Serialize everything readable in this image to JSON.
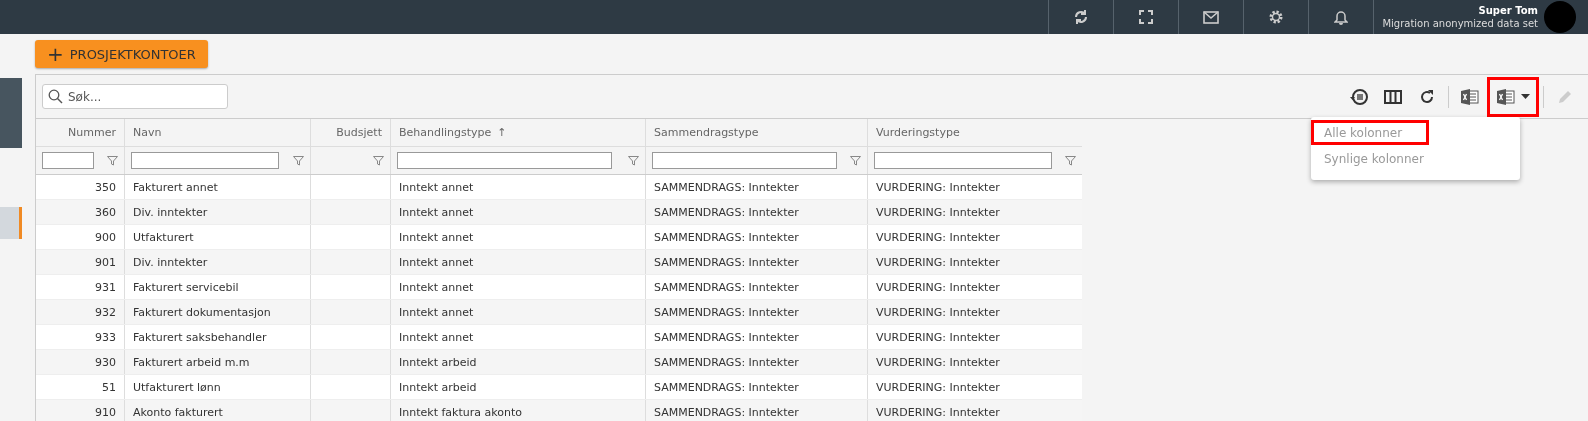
{
  "header": {
    "user_name": "Super Tom",
    "dataset": "Migration anonymized data set"
  },
  "add_button": {
    "icon": "+",
    "label": "PROSJEKTKONTOER"
  },
  "search": {
    "placeholder": "Søk..."
  },
  "toolbar": {
    "export_button": {
      "highlighted": true
    },
    "menu": [
      {
        "label": "Alle kolonner",
        "highlighted": true
      },
      {
        "label": "Synlige kolonner",
        "highlighted": false
      }
    ]
  },
  "table": {
    "columns": [
      {
        "label": "Nummer",
        "numeric": true,
        "sorted": false
      },
      {
        "label": "Navn",
        "numeric": false,
        "sorted": false
      },
      {
        "label": "Budsjett",
        "numeric": true,
        "sorted": false
      },
      {
        "label": "Behandlingstype",
        "numeric": false,
        "sorted": true
      },
      {
        "label": "Sammendragstype",
        "numeric": false,
        "sorted": false
      },
      {
        "label": "Vurderingstype",
        "numeric": false,
        "sorted": false
      }
    ],
    "sort_icon": "↑",
    "rows": [
      [
        "350",
        "Fakturert annet",
        "",
        "Inntekt annet",
        "SAMMENDRAGS: Inntekter",
        "VURDERING: Inntekter"
      ],
      [
        "360",
        "Div. inntekter",
        "",
        "Inntekt annet",
        "SAMMENDRAGS: Inntekter",
        "VURDERING: Inntekter"
      ],
      [
        "900",
        "Utfakturert",
        "",
        "Inntekt annet",
        "SAMMENDRAGS: Inntekter",
        "VURDERING: Inntekter"
      ],
      [
        "901",
        "Div. inntekter",
        "",
        "Inntekt annet",
        "SAMMENDRAGS: Inntekter",
        "VURDERING: Inntekter"
      ],
      [
        "931",
        "Fakturert servicebil",
        "",
        "Inntekt annet",
        "SAMMENDRAGS: Inntekter",
        "VURDERING: Inntekter"
      ],
      [
        "932",
        "Fakturert dokumentasjon",
        "",
        "Inntekt annet",
        "SAMMENDRAGS: Inntekter",
        "VURDERING: Inntekter"
      ],
      [
        "933",
        "Fakturert saksbehandler",
        "",
        "Inntekt annet",
        "SAMMENDRAGS: Inntekter",
        "VURDERING: Inntekter"
      ],
      [
        "930",
        "Fakturert arbeid m.m",
        "",
        "Inntekt arbeid",
        "SAMMENDRAGS: Inntekter",
        "VURDERING: Inntekter"
      ],
      [
        "51",
        "Utfakturert lønn",
        "",
        "Inntekt arbeid",
        "SAMMENDRAGS: Inntekter",
        "VURDERING: Inntekter"
      ],
      [
        "910",
        "Akonto fakturert",
        "",
        "Inntekt faktura akonto",
        "SAMMENDRAGS: Inntekter",
        "VURDERING: Inntekter"
      ]
    ]
  }
}
